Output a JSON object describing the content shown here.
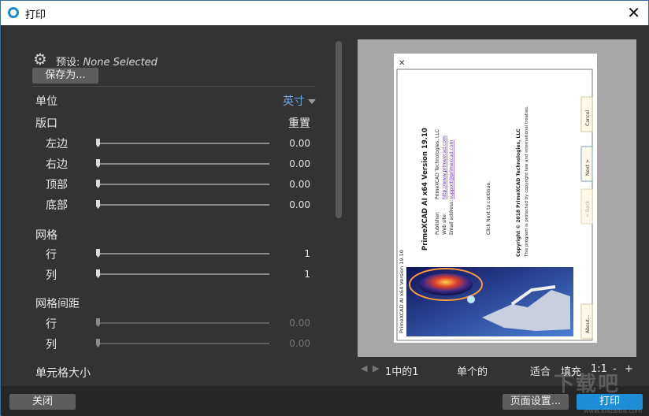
{
  "window": {
    "title": "打印",
    "close_symbol": "✕"
  },
  "preset": {
    "label": "预设:",
    "value": "None Selected",
    "save_as_button": "保存为..."
  },
  "units": {
    "label": "单位",
    "value": "英寸"
  },
  "margins": {
    "header": "版口",
    "reset": "重置",
    "rows": [
      {
        "label": "左边",
        "value": "0.00"
      },
      {
        "label": "右边",
        "value": "0.00"
      },
      {
        "label": "顶部",
        "value": "0.00"
      },
      {
        "label": "底部",
        "value": "0.00"
      }
    ]
  },
  "grid": {
    "header": "网格",
    "rows": [
      {
        "label": "行",
        "value": "1"
      },
      {
        "label": "列",
        "value": "1"
      }
    ]
  },
  "grid_spacing": {
    "header": "网格间距",
    "rows": [
      {
        "label": "行",
        "value": "0.00"
      },
      {
        "label": "列",
        "value": "0.00"
      }
    ]
  },
  "cell_size": {
    "header": "单元格大小"
  },
  "preview_content": {
    "app_title": "PrimeXCAD AI x64 Version 19.10",
    "company_name": "PrimeXCAD Technologies, LLC",
    "website": "http://www.primexcad.com",
    "email": "support@primexcad.com",
    "email_label": "Email address:",
    "publisher_label": "Publisher:",
    "website_label": "Web site:",
    "instruction": "Click Next to continue.",
    "copyright": "Copyright © 2018 PrimeXCAD Technologies, LLC",
    "legal": "This program is protected by copyright law and international treaties.",
    "buttons": [
      "About...",
      "< Back",
      "Next >",
      "Cancel"
    ]
  },
  "nav": {
    "page_info": "1中的1",
    "single_label": "单个的",
    "fit_label": "适合",
    "fill_label": "填充",
    "ratio_label": "1:1",
    "zoom_out": "-",
    "zoom_in": "+"
  },
  "footer": {
    "close": "关闭",
    "page_setup": "页面设置...",
    "print": "打印"
  },
  "watermark": {
    "text": "下载吧",
    "url": "www.xiazaiba.com"
  },
  "colors": {
    "accent": "#1f8ed8",
    "link": "#6aa8e6",
    "panel": "#333333"
  }
}
